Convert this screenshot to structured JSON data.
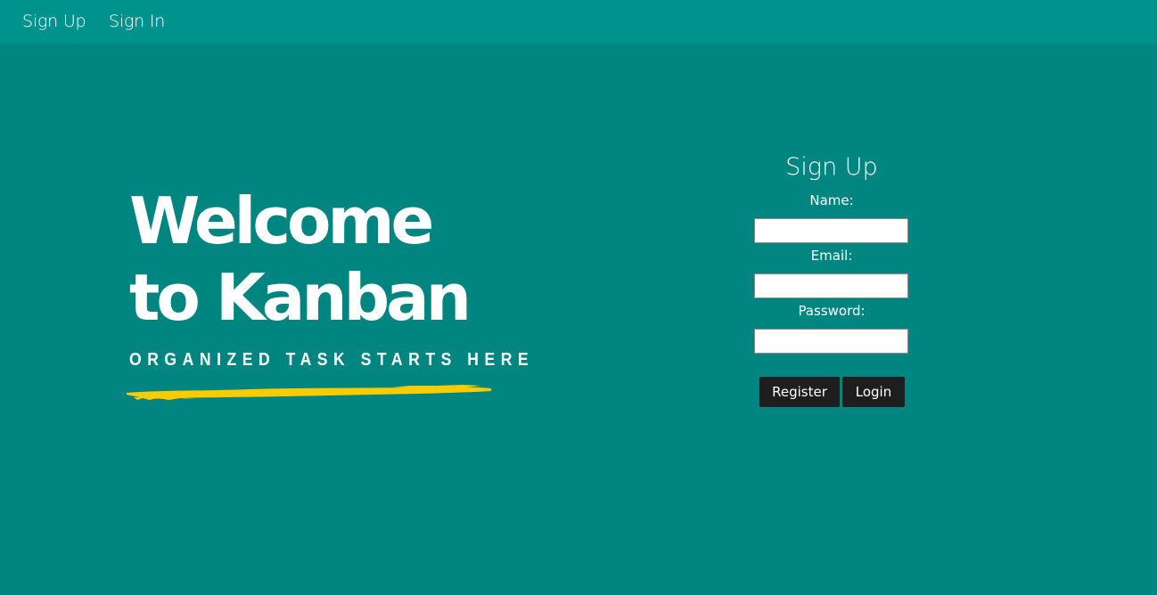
{
  "navbar": {
    "links": [
      {
        "label": "Sign Up"
      },
      {
        "label": "Sign In"
      }
    ]
  },
  "hero": {
    "title_line1": "Welcome",
    "title_line2": "to Kanban",
    "tagline": "ORGANIZED TASK STARTS HERE",
    "brush_color": "#f9cc00"
  },
  "form": {
    "title": "Sign Up",
    "name_label": "Name:",
    "name_value": "",
    "email_label": "Email:",
    "email_value": "",
    "password_label": "Password:",
    "password_value": "",
    "register_label": "Register",
    "login_label": "Login"
  },
  "colors": {
    "background": "#008580",
    "navbar": "#00938e",
    "button": "#1e1e1e",
    "accent": "#f9cc00"
  }
}
